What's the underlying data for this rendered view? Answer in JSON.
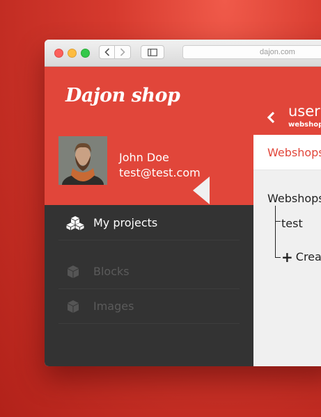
{
  "browser": {
    "url": "dajon.com"
  },
  "sidebar": {
    "logo": "Dajon shop",
    "user": {
      "name": "John Doe",
      "email": "test@test.com"
    },
    "items": [
      {
        "label": "My projects",
        "icon": "cubes-icon",
        "state": "active"
      },
      {
        "label": "Blocks",
        "icon": "cube-icon",
        "state": "dim"
      },
      {
        "label": "Images",
        "icon": "cube-icon",
        "state": "dim"
      }
    ]
  },
  "header": {
    "title": "user",
    "subtitle": "webshop",
    "back_icon": "chevron-left-icon"
  },
  "tabs": {
    "active": "Webshops"
  },
  "tree": {
    "root": "Webshops",
    "children": [
      "test"
    ],
    "create_label": "Creat"
  },
  "colors": {
    "brand_red": "#e1463a",
    "sidebar_dark": "#333333",
    "content_bg": "#f0f0f0"
  }
}
